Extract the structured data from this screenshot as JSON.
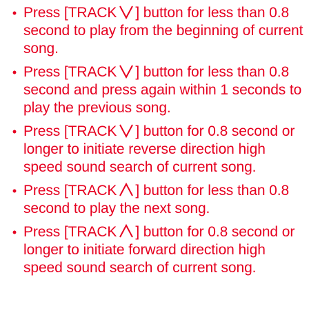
{
  "style": {
    "text_color": "#e60020",
    "background": "#ffffff"
  },
  "instructions": [
    {
      "before": "Press [TRACK",
      "icon": "down-chevron-icon",
      "after": "] button for less than 0.8 second to play from the beginning of current song."
    },
    {
      "before": "Press [TRACK",
      "icon": "down-chevron-icon",
      "after": "] button for less than 0.8 second and press again within 1 seconds to play the previous song."
    },
    {
      "before": "Press [TRACK",
      "icon": "down-chevron-icon",
      "after": "] button for 0.8 second or longer to initiate reverse direction high speed sound search of current song."
    },
    {
      "before": "Press [TRACK",
      "icon": "up-chevron-icon",
      "after": "] button for less than 0.8 second to play the next song."
    },
    {
      "before": "Press [TRACK",
      "icon": "up-chevron-icon",
      "after": "] button for 0.8 second or longer to initiate forward direction high speed sound search of current song."
    }
  ]
}
